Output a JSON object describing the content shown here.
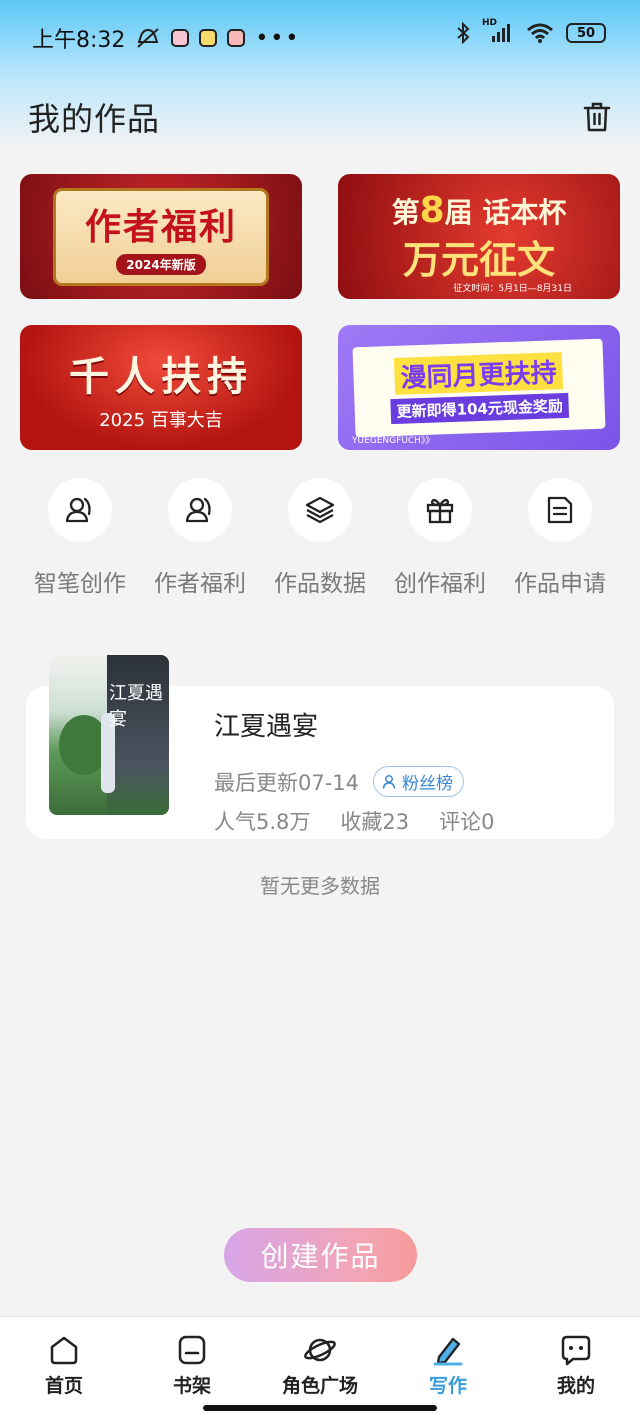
{
  "status_bar": {
    "time": "上午8:32",
    "battery": "50",
    "network_label": "HD"
  },
  "header": {
    "title": "我的作品",
    "trash_icon": "trash-icon"
  },
  "banners": [
    {
      "line1": "作者福利",
      "line2": "2024年新版"
    },
    {
      "line1a": "第",
      "line1b": "8",
      "line1c": "届",
      "line1d": "话本杯",
      "line2": "万元征文",
      "line3": "征文时间：5月1日—8月31日"
    },
    {
      "line1": "千人扶持",
      "line2": "2025 百事大吉"
    },
    {
      "line1": "漫同月更扶持",
      "line2": "更新即得104元现金奖励",
      "line3": "YUEGENGFUCH》》"
    }
  ],
  "quick_actions": [
    {
      "label": "智笔创作",
      "icon": "user-pen-icon"
    },
    {
      "label": "作者福利",
      "icon": "users-icon"
    },
    {
      "label": "作品数据",
      "icon": "layers-icon"
    },
    {
      "label": "创作福利",
      "icon": "gift-icon"
    },
    {
      "label": "作品申请",
      "icon": "document-icon"
    }
  ],
  "work": {
    "title": "江夏遇宴",
    "cover_text": "江夏遇宴",
    "last_update": "最后更新07-14",
    "fans_badge": "粉丝榜",
    "popularity": "人气5.8万",
    "favorites": "收藏23",
    "comments": "评论0"
  },
  "no_more": "暂无更多数据",
  "create_button": "创建作品",
  "tabs": [
    {
      "label": "首页",
      "icon": "home-icon",
      "active": false
    },
    {
      "label": "书架",
      "icon": "bookshelf-icon",
      "active": false
    },
    {
      "label": "角色广场",
      "icon": "planet-icon",
      "active": false
    },
    {
      "label": "写作",
      "icon": "pen-icon",
      "active": true
    },
    {
      "label": "我的",
      "icon": "chat-face-icon",
      "active": false
    }
  ],
  "colors": {
    "accent": "#3a9bd8",
    "create_gradient_start": "#d6a5e8",
    "create_gradient_end": "#f69a9a"
  }
}
